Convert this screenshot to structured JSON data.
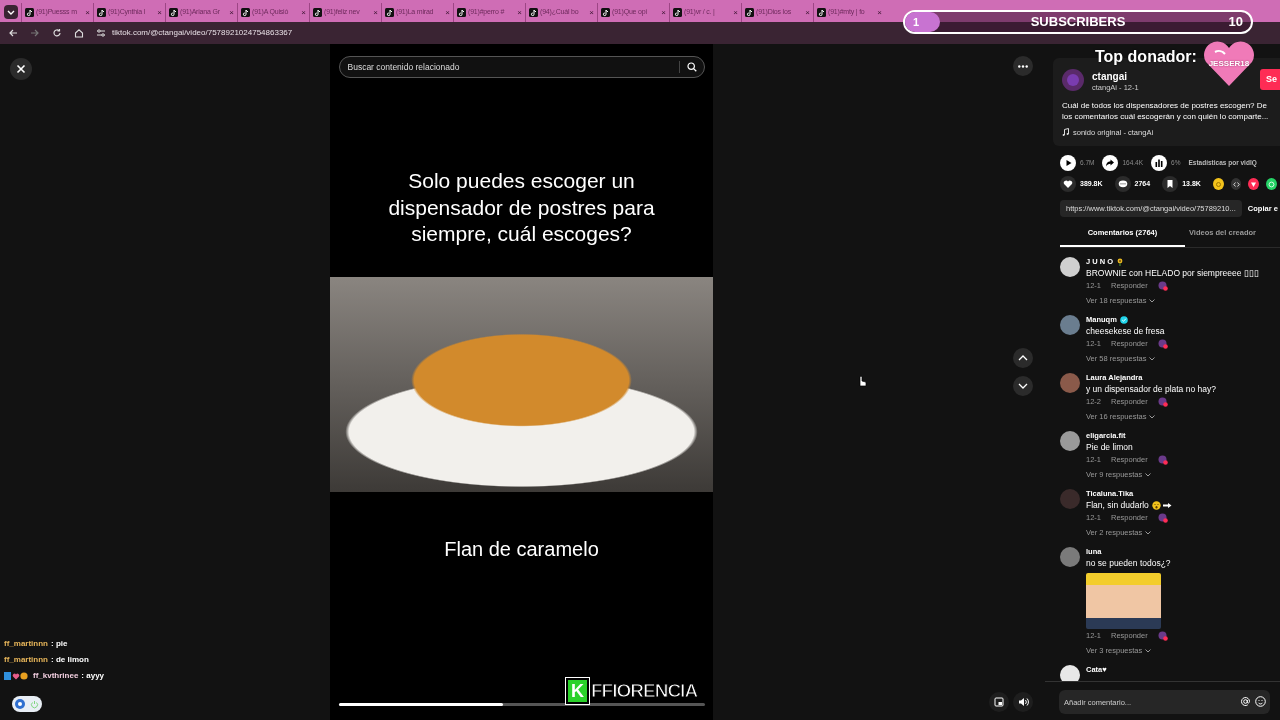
{
  "browser": {
    "tabs": [
      {
        "title": "(91)Puesss m",
        "close": "×",
        "selected": false
      },
      {
        "title": "(91)Cynthia l",
        "close": "×",
        "selected": false
      },
      {
        "title": "(91)Ariana Gr",
        "close": "×",
        "selected": false
      },
      {
        "title": "(91)A Quisió",
        "close": "×",
        "selected": false
      },
      {
        "title": "(91)feliz nev",
        "close": "×",
        "selected": false
      },
      {
        "title": "(91)La mirad",
        "close": "×",
        "selected": false
      },
      {
        "title": "(91)#perro #",
        "close": "×",
        "selected": false
      },
      {
        "title": "(94)¿Cuál bo",
        "close": "×",
        "selected": false
      },
      {
        "title": "(91)Que opi",
        "close": "×",
        "selected": false
      },
      {
        "title": "(91)vr / c. |",
        "close": "×",
        "selected": false
      },
      {
        "title": "(91)Dios los",
        "close": "×",
        "selected": false
      },
      {
        "title": "(91)#mty | fo",
        "close": "×",
        "selected": false
      }
    ],
    "address": "tiktok.com/@ctangai/video/7578921024754863367"
  },
  "subscribers_overlay": {
    "current": "1",
    "label": "SUBSCRIBERS",
    "goal": "10",
    "level": 0.1
  },
  "top_donor": {
    "label": "Top donador:",
    "name": "JESSER18"
  },
  "video": {
    "search_placeholder": "Buscar contenido relacionado",
    "headline": "Solo puedes escoger un dispensador de postres para siempre, cuál escoges?",
    "caption": "Flan de caramelo",
    "level": 0.45
  },
  "stream_chat": [
    {
      "user": "ff_martinnn",
      "text": ": pie",
      "color": "#e8b65a",
      "badges": false
    },
    {
      "user": "ff_martinnn",
      "text": ": de limon",
      "color": "#e8b65a",
      "badges": false
    },
    {
      "user": "ff_kvthrinee",
      "text": ": ayyy",
      "color": "#f3cfe0",
      "badges": true
    }
  ],
  "logo": {
    "mark": "K",
    "name": "FFIORENCIA"
  },
  "post": {
    "author": "ctangai",
    "byline": "ctangAi - 12-1",
    "follow": "Se",
    "description": [
      "Cuál de todos los dispensadores de postres escogen? De",
      "los comentarios cuál escogerán y con quién lo comparte..."
    ],
    "music": "sonido original - ctangAi",
    "stats": [
      {
        "kind": "play",
        "value": "6.7M"
      },
      {
        "kind": "share",
        "value": "164.4K"
      },
      {
        "kind": "chart",
        "value": "6%"
      }
    ],
    "stats_label": "Estadísticas por vidIQ",
    "actions": [
      {
        "kind": "like",
        "count": "389.8K"
      },
      {
        "kind": "comment",
        "count": "2764"
      },
      {
        "kind": "bookmark",
        "count": "13.8K"
      }
    ],
    "share_targets": [
      {
        "kind": "coin",
        "color": "#f2c21b"
      },
      {
        "kind": "embed",
        "color": "#333333"
      },
      {
        "kind": "send",
        "color": "#fe2c55"
      },
      {
        "kind": "chat",
        "color": "#25d366"
      }
    ],
    "link": "https://www.tiktok.com/@ctangai/video/75789210...",
    "copy": "Copiar e"
  },
  "panel_tabs": [
    {
      "label": "Comentarios (2764)",
      "selected": true
    },
    {
      "label": "Videos del creador",
      "selected": false
    }
  ],
  "comments": [
    {
      "user": "J U N O",
      "flower": true,
      "verified": false,
      "text": "BROWNIE con HELADO por siempreeee ▯▯▯",
      "emojis": false,
      "sticker": false,
      "date": "12-1",
      "reply": "Responder",
      "replies": "Ver 18 respuestas"
    },
    {
      "user": "Manuqm",
      "flower": false,
      "verified": true,
      "text": "cheesekese de fresa",
      "emojis": false,
      "sticker": false,
      "date": "12-1",
      "reply": "Responder",
      "replies": "Ver 58 respuestas"
    },
    {
      "user": "Laura Alejandra",
      "flower": false,
      "verified": false,
      "text": "y un dispensador de plata no hay?",
      "emojis": false,
      "sticker": false,
      "date": "12-2",
      "reply": "Responder",
      "replies": "Ver 16 respuestas"
    },
    {
      "user": "eligarcia.fit",
      "flower": false,
      "verified": false,
      "text": "Pie de limon",
      "emojis": false,
      "sticker": false,
      "date": "12-1",
      "reply": "Responder",
      "replies": "Ver 9 respuestas"
    },
    {
      "user": "Ticaluna.Tika",
      "flower": false,
      "verified": false,
      "text": "Flan, sin dudarlo",
      "emojis": true,
      "sticker": false,
      "date": "12-1",
      "reply": "Responder",
      "replies": "Ver 2 respuestas"
    },
    {
      "user": "luna",
      "flower": false,
      "verified": false,
      "text": "no se pueden todos¿?",
      "emojis": false,
      "sticker": true,
      "date": "12-1",
      "reply": "Responder",
      "replies": "Ver 3 respuestas"
    },
    {
      "user": "Cata♥",
      "flower": false,
      "verified": false,
      "emojis": false,
      "sticker": false
    }
  ],
  "comment_input": {
    "placeholder": "Añadir comentario..."
  }
}
